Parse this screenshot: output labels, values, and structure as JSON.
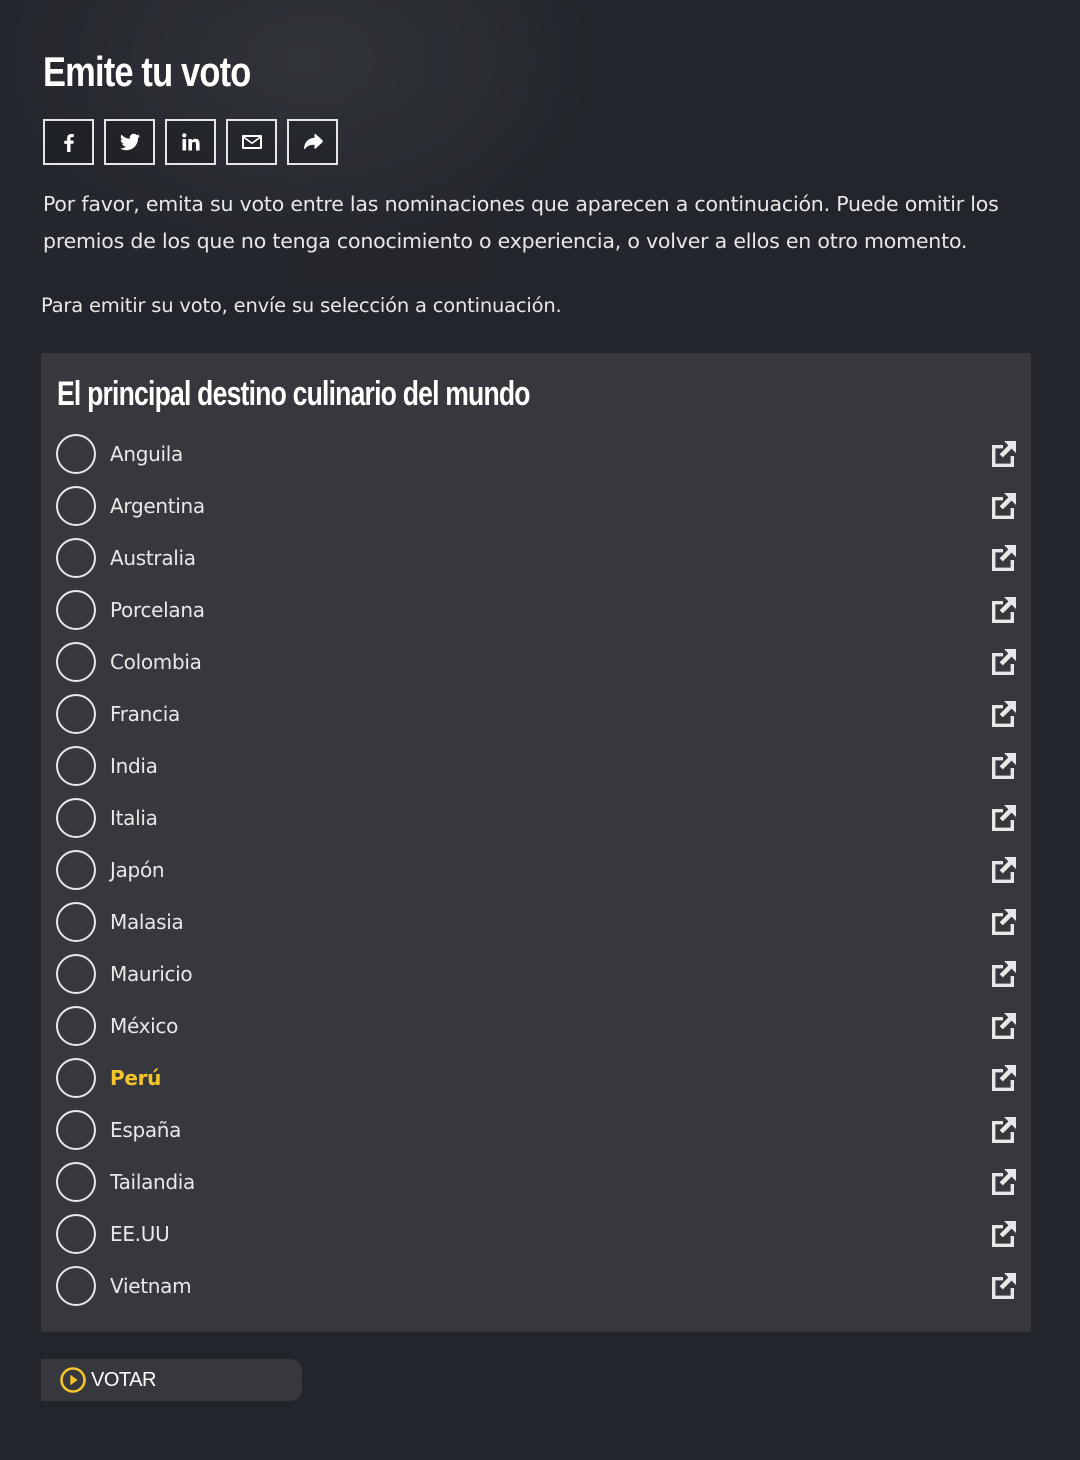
{
  "header": {
    "title": "Emite tu voto",
    "share_buttons": [
      {
        "icon": "facebook-icon"
      },
      {
        "icon": "twitter-icon"
      },
      {
        "icon": "linkedin-icon"
      },
      {
        "icon": "mail-icon"
      },
      {
        "icon": "share-icon"
      }
    ],
    "intro": "Por favor, emita su voto entre las nominaciones que aparecen a continuación. Puede omitir los premios de los que no tenga conocimiento o experiencia, o volver a ellos en otro momento."
  },
  "submit_hint": "Para emitir su voto, envíe su selección a continuación.",
  "category": {
    "title": "El principal destino culinario del mundo",
    "options": [
      {
        "label": "Anguila",
        "highlight": false
      },
      {
        "label": "Argentina",
        "highlight": false
      },
      {
        "label": "Australia",
        "highlight": false
      },
      {
        "label": "Porcelana",
        "highlight": false
      },
      {
        "label": "Colombia",
        "highlight": false
      },
      {
        "label": "Francia",
        "highlight": false
      },
      {
        "label": "India",
        "highlight": false
      },
      {
        "label": "Italia",
        "highlight": false
      },
      {
        "label": "Japón",
        "highlight": false
      },
      {
        "label": "Malasia",
        "highlight": false
      },
      {
        "label": "Mauricio",
        "highlight": false
      },
      {
        "label": "México",
        "highlight": false
      },
      {
        "label": "Perú",
        "highlight": true
      },
      {
        "label": "España",
        "highlight": false
      },
      {
        "label": "Tailandia",
        "highlight": false
      },
      {
        "label": "EE.UU",
        "highlight": false
      },
      {
        "label": "Vietnam",
        "highlight": false
      }
    ]
  },
  "vote_button": {
    "label": "VOTAR"
  },
  "colors": {
    "background": "#22252b",
    "panel": "#36383d",
    "accent": "#f5c42a",
    "text": "#e8e8e8"
  }
}
